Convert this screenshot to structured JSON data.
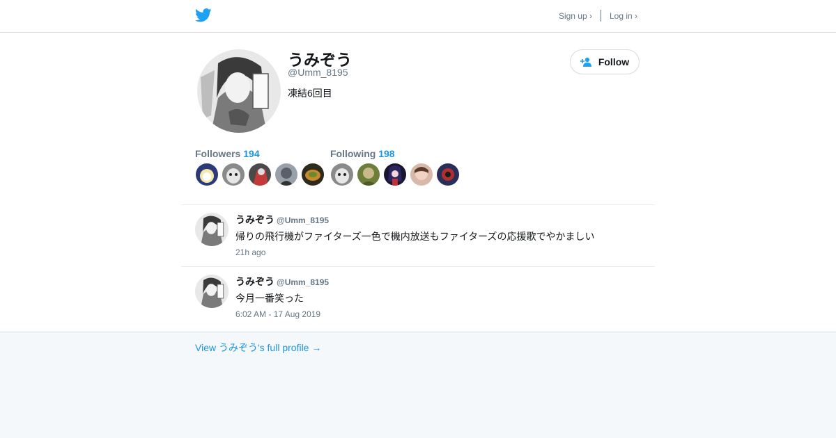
{
  "topbar": {
    "signup_label": "Sign up ›",
    "login_label": "Log in ›",
    "brand_color": "#1da1f2"
  },
  "profile": {
    "name": "うみぞう",
    "handle": "@Umm_8195",
    "bio": "凍結6回目",
    "follow_label": "Follow"
  },
  "stats": {
    "followers_label": "Followers",
    "followers_count": "194",
    "following_label": "Following",
    "following_count": "198"
  },
  "tweets": [
    {
      "name": "うみぞう",
      "handle": "@Umm_8195",
      "text": "帰りの飛行機がファイターズ一色で機内放送もファイターズの応援歌でやかましい",
      "time": "21h ago"
    },
    {
      "name": "うみぞう",
      "handle": "@Umm_8195",
      "text": "今月一番笑った",
      "time": "6:02 AM - 17 Aug 2019"
    }
  ],
  "footer": {
    "full_profile_link": "View うみぞう's full profile →"
  }
}
